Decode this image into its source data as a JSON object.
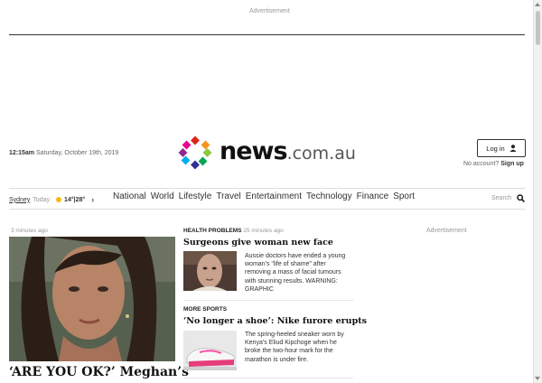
{
  "ads": {
    "top_label": "Advertisement",
    "side_label": "Advertisement"
  },
  "header": {
    "time": "12:15am",
    "date": "Saturday, October 19th, 2019",
    "logo_name": "news",
    "logo_domain": ".com.au",
    "login_label": "Log in",
    "no_account": "No account?",
    "signup_label": "Sign up"
  },
  "location": {
    "city": "Sydney",
    "today": "Today",
    "temp": "14°|28°"
  },
  "nav": [
    "National",
    "World",
    "Lifestyle",
    "Travel",
    "Entertainment",
    "Technology",
    "Finance",
    "Sport"
  ],
  "search": {
    "label": "Search"
  },
  "hero": {
    "time": "3 minutes ago",
    "title": "‘ARE YOU OK?’ Meghan’s"
  },
  "stories": [
    {
      "category": "HEALTH PROBLEMS",
      "time": "25 minutes ago",
      "headline": "Surgeons give woman new face",
      "blurb": "Aussie doctors have ended a young woman’s “life of shame” after removing a mass of facial tumours with stunning results. WARNING: GRAPHIC"
    },
    {
      "category": "MORE SPORTS",
      "time": "",
      "headline": "‘No longer a shoe’: Nike furore erupts",
      "blurb": "The spring-heeled sneaker worn by Kenya’s Eliud Kipchoge when he broke the two-hour mark for the marathon is under fire."
    }
  ],
  "logo_colors": [
    "#e2231a",
    "#f7941d",
    "#8dc63f",
    "#00a651",
    "#2e3192",
    "#00aeef",
    "#92278f",
    "#ec008c"
  ]
}
